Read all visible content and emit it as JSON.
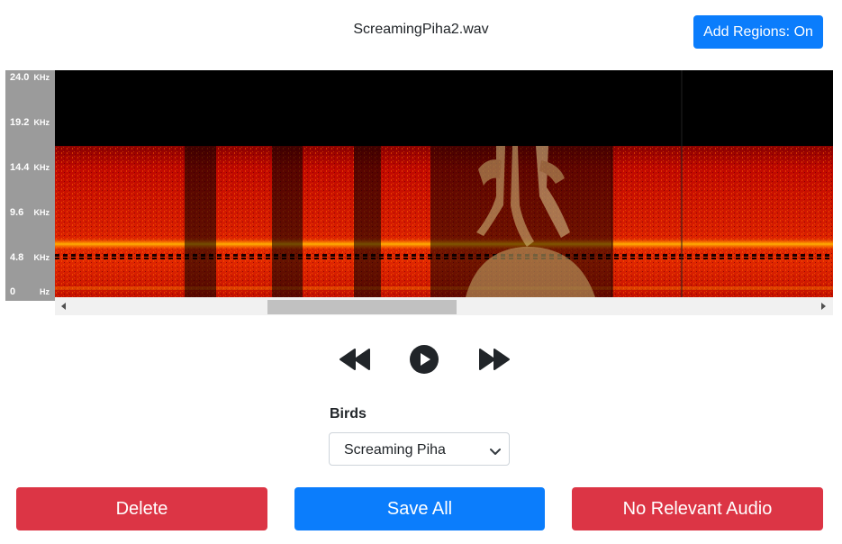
{
  "header": {
    "filename": "ScreamingPiha2.wav",
    "add_regions_label": "Add Regions: On"
  },
  "frequency_axis": {
    "ticks": [
      {
        "value": "24.0",
        "unit": "KHz"
      },
      {
        "value": "19.2",
        "unit": "KHz"
      },
      {
        "value": "14.4",
        "unit": "KHz"
      },
      {
        "value": "9.6",
        "unit": "KHz"
      },
      {
        "value": "4.8",
        "unit": "KHz"
      },
      {
        "value": "0",
        "unit": "Hz"
      }
    ]
  },
  "playback": {
    "rewind_icon": "rewind-icon",
    "play_icon": "play-icon",
    "fast_forward_icon": "fast-forward-icon"
  },
  "species": {
    "label": "Birds",
    "selected": "Screaming Piha"
  },
  "actions": {
    "delete_label": "Delete",
    "save_label": "Save All",
    "no_audio_label": "No Relevant Audio"
  },
  "colors": {
    "primary": "#0b7dfc",
    "danger": "#dc3545",
    "axis_bg": "#9b9b9b",
    "spectrogram_hot": "#ff3a00"
  }
}
